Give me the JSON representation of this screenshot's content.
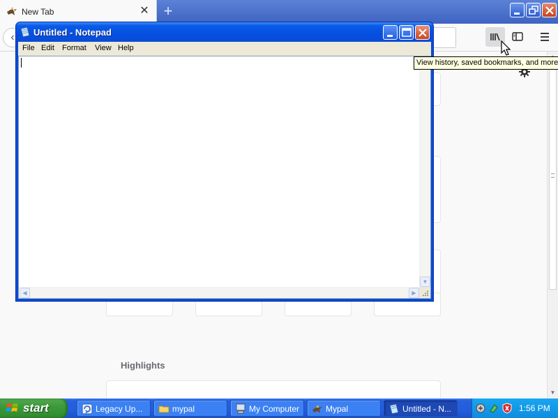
{
  "browser": {
    "tab": {
      "title": "New Tab",
      "favicon": "mypal-bird-icon",
      "close_glyph": "✕"
    },
    "newtab_glyph": "+",
    "back_glyph": "‹",
    "toolbar": {
      "library_icon": "library-icon",
      "sidebar_icon": "sidebar-icon",
      "menu_icon": "hamburger-menu-icon"
    },
    "newtab_page": {
      "highlights_title": "Highlights",
      "settings_icon": "gear-icon"
    },
    "tooltip": "View history, saved bookmarks, and more"
  },
  "notepad": {
    "title": "Untitled - Notepad",
    "menu": [
      "File",
      "Edit",
      "Format",
      "View",
      "Help"
    ],
    "content": ""
  },
  "taskbar": {
    "start_label": "start",
    "tasks": [
      {
        "label": "Legacy Up...",
        "icon": "legacy-update-icon",
        "active": false
      },
      {
        "label": "mypal",
        "icon": "folder-icon",
        "active": false
      },
      {
        "label": "My Computer",
        "icon": "my-computer-icon",
        "active": false
      },
      {
        "label": "Mypal",
        "icon": "mypal-bird-icon",
        "active": false
      },
      {
        "label": "Untitled - N...",
        "icon": "notepad-icon",
        "active": true
      }
    ],
    "tray": {
      "icons": [
        "network-icon",
        "safely-remove-icon",
        "security-shield-icon"
      ],
      "clock": "1:56 PM"
    }
  },
  "colors": {
    "xp_blue": "#245ddb",
    "start_green": "#3c9a3a",
    "tooltip_bg": "#ffffe1"
  }
}
